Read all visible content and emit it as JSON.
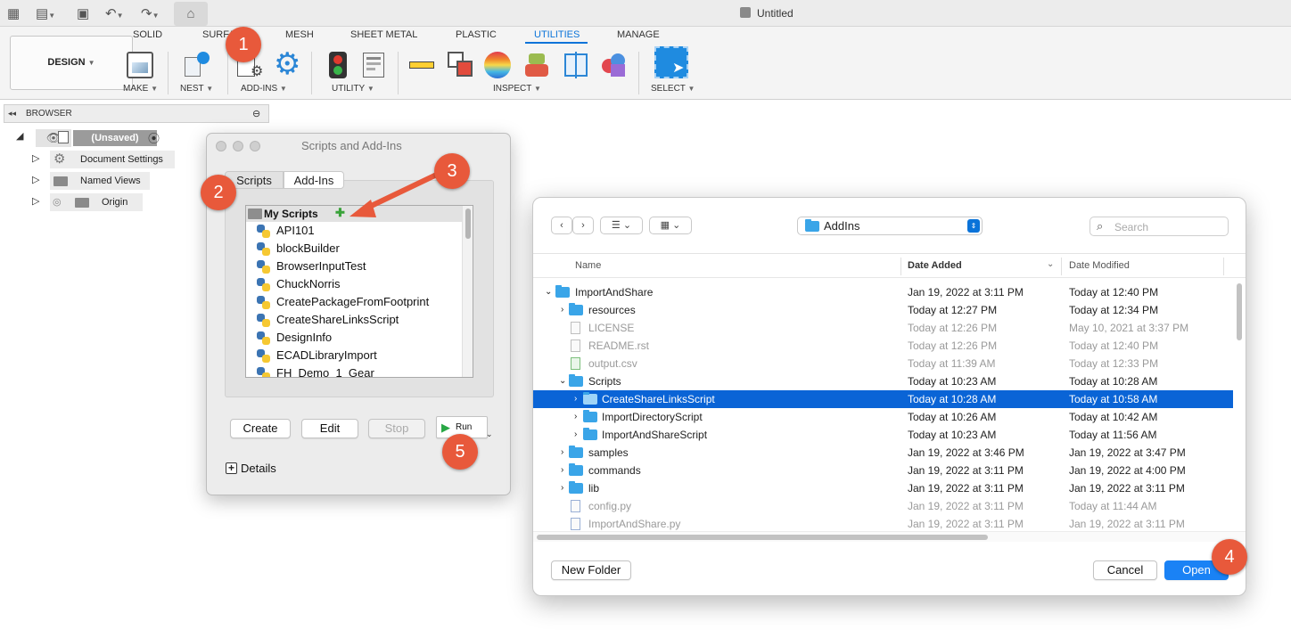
{
  "window": {
    "title": "Untitled"
  },
  "ribbon": {
    "tabs": [
      "SOLID",
      "SURFACE",
      "MESH",
      "SHEET METAL",
      "PLASTIC",
      "UTILITIES",
      "MANAGE"
    ],
    "active_tab": "UTILITIES",
    "design_button": "DESIGN",
    "groups": {
      "make": "MAKE",
      "nest": "NEST",
      "addins": "ADD-INS",
      "utility": "UTILITY",
      "inspect": "INSPECT",
      "select": "SELECT"
    }
  },
  "browser": {
    "header": "BROWSER",
    "root": "(Unsaved)",
    "items": [
      "Document Settings",
      "Named Views",
      "Origin"
    ]
  },
  "scripts_dialog": {
    "title": "Scripts and Add-Ins",
    "tabs": [
      "Scripts",
      "Add-Ins"
    ],
    "folder": "My Scripts",
    "scripts": [
      "API101",
      "blockBuilder",
      "BrowserInputTest",
      "ChuckNorris",
      "CreatePackageFromFootprint",
      "CreateShareLinksScript",
      "DesignInfo",
      "ECADLibraryImport",
      "FH_Demo_1_Gear"
    ],
    "buttons": {
      "create": "Create",
      "edit": "Edit",
      "stop": "Stop",
      "run": "Run"
    },
    "details": "Details"
  },
  "file_dialog": {
    "location": "AddIns",
    "search_placeholder": "Search",
    "columns": {
      "name": "Name",
      "date_added": "Date Added",
      "date_modified": "Date Modified"
    },
    "rows": [
      {
        "name": "ImportAndShare",
        "added": "Jan 19, 2022 at 3:11 PM",
        "modified": "Today at 12:40 PM"
      },
      {
        "name": "resources",
        "added": "Today at 12:27 PM",
        "modified": "Today at 12:34 PM"
      },
      {
        "name": "LICENSE",
        "added": "Today at 12:26 PM",
        "modified": "May 10, 2021 at 3:37 PM"
      },
      {
        "name": "README.rst",
        "added": "Today at 12:26 PM",
        "modified": "Today at 12:40 PM"
      },
      {
        "name": "output.csv",
        "added": "Today at 11:39 AM",
        "modified": "Today at 12:33 PM"
      },
      {
        "name": "Scripts",
        "added": "Today at 10:23 AM",
        "modified": "Today at 10:28 AM"
      },
      {
        "name": "CreateShareLinksScript",
        "added": "Today at 10:28 AM",
        "modified": "Today at 10:58 AM"
      },
      {
        "name": "ImportDirectoryScript",
        "added": "Today at 10:26 AM",
        "modified": "Today at 10:42 AM"
      },
      {
        "name": "ImportAndShareScript",
        "added": "Today at 10:23 AM",
        "modified": "Today at 11:56 AM"
      },
      {
        "name": "samples",
        "added": "Jan 19, 2022 at 3:46 PM",
        "modified": "Jan 19, 2022 at 3:47 PM"
      },
      {
        "name": "commands",
        "added": "Jan 19, 2022 at 3:11 PM",
        "modified": "Jan 19, 2022 at 4:00 PM"
      },
      {
        "name": "lib",
        "added": "Jan 19, 2022 at 3:11 PM",
        "modified": "Jan 19, 2022 at 3:11 PM"
      },
      {
        "name": "config.py",
        "added": "Jan 19, 2022 at 3:11 PM",
        "modified": "Today at 11:44 AM"
      },
      {
        "name": "ImportAndShare.py",
        "added": "Jan 19, 2022 at 3:11 PM",
        "modified": "Jan 19, 2022 at 3:11 PM"
      }
    ],
    "buttons": {
      "new_folder": "New Folder",
      "cancel": "Cancel",
      "open": "Open"
    }
  },
  "callouts": [
    "1",
    "2",
    "3",
    "4",
    "5"
  ],
  "colors": {
    "accent": "#0a64d6",
    "callout": "#e8593b",
    "folder": "#3aa5e8"
  }
}
